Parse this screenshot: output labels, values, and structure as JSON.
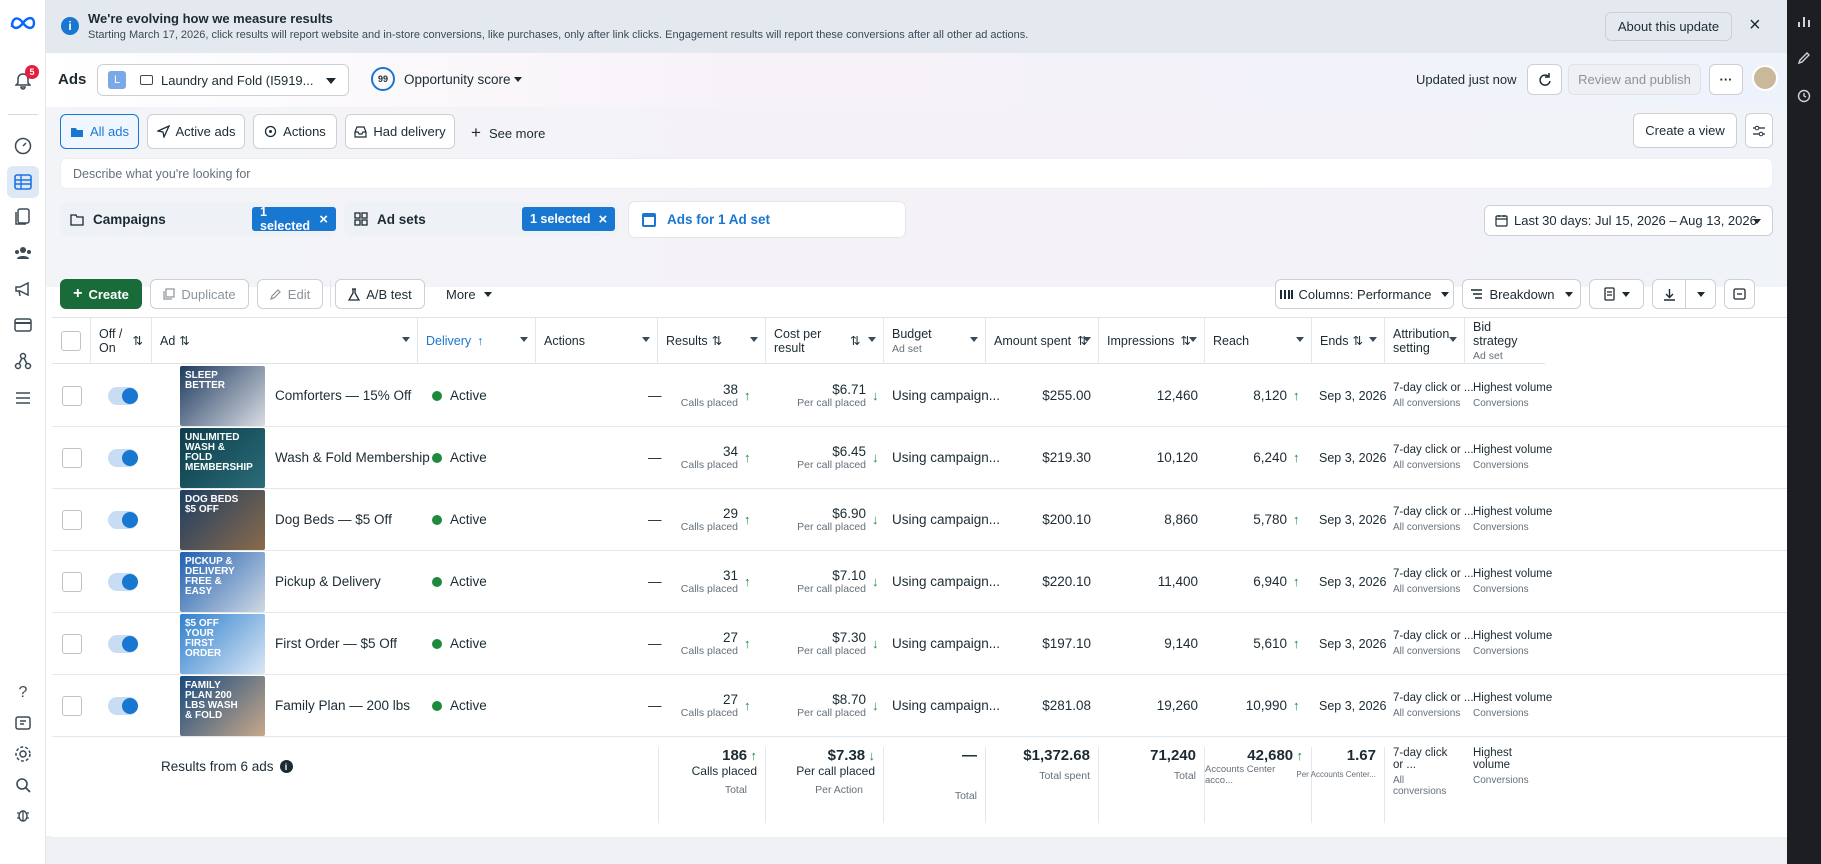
{
  "banner": {
    "title": "We're evolving how we measure results",
    "subtitle": "Starting March 17, 2026, click results will report website and in-store conversions, like purchases, only after link clicks. Engagement results will report these conversions after all other ad actions.",
    "about_button": "About this update"
  },
  "leftnav": {
    "notification_count": "5"
  },
  "topbar": {
    "section_title": "Ads",
    "account_initial": "L",
    "account_name": "Laundry and Fold (I5919...",
    "opportunity_score_value": "99",
    "opportunity_score_label": "Opportunity score",
    "updated_text": "Updated just now",
    "review_publish": "Review and publish",
    "more_label": "···"
  },
  "views": {
    "tabs": [
      "All ads",
      "Active ads",
      "Actions",
      "Had delivery"
    ],
    "see_more": "See more",
    "create_view": "Create a view"
  },
  "search": {
    "placeholder": "Describe what you're looking for"
  },
  "levels": {
    "campaigns": "Campaigns",
    "campaigns_selected": "1 selected",
    "adsets": "Ad sets",
    "adsets_selected": "1 selected",
    "ads": "Ads for 1 Ad set"
  },
  "date_range": "Last 30 days: Jul 15, 2026 – Aug 13, 2026",
  "toolbar": {
    "create": "Create",
    "duplicate": "Duplicate",
    "edit": "Edit",
    "ab_test": "A/B test",
    "more": "More",
    "columns": "Columns: Performance",
    "breakdown": "Breakdown"
  },
  "columns": {
    "onoff": "Off / On",
    "ad": "Ad",
    "delivery": "Delivery",
    "actions": "Actions",
    "results": "Results",
    "cost": "Cost per result",
    "budget": "Budget",
    "budget_sub": "Ad set",
    "amount": "Amount spent",
    "impressions": "Impressions",
    "reach": "Reach",
    "ends": "Ends",
    "attribution": "Attribution setting",
    "bid": "Bid strategy",
    "bid_sub": "Ad set"
  },
  "rows": [
    {
      "thumb": "SLEEP BETTER",
      "name": "Comforters — 15% Off",
      "delivery": "Active",
      "actions": "—",
      "results": "38",
      "results_sub": "Calls placed",
      "cost": "$6.71",
      "cost_sub": "Per call placed",
      "budget": "Using campaign...",
      "amount": "$255.00",
      "impressions": "12,460",
      "reach": "8,120",
      "ends": "Sep 3, 2026",
      "attr": "7-day click or ...",
      "attr_sub": "All conversions",
      "bid": "Highest volume",
      "bid_sub": "Conversions"
    },
    {
      "thumb": "UNLIMITED WASH & FOLD MEMBERSHIP",
      "name": "Wash & Fold Membership",
      "delivery": "Active",
      "actions": "—",
      "results": "34",
      "results_sub": "Calls placed",
      "cost": "$6.45",
      "cost_sub": "Per call placed",
      "budget": "Using campaign...",
      "amount": "$219.30",
      "impressions": "10,120",
      "reach": "6,240",
      "ends": "Sep 3, 2026",
      "attr": "7-day click or ...",
      "attr_sub": "All conversions",
      "bid": "Highest volume",
      "bid_sub": "Conversions"
    },
    {
      "thumb": "DOG BEDS $5 OFF",
      "name": "Dog Beds — $5 Off",
      "delivery": "Active",
      "actions": "—",
      "results": "29",
      "results_sub": "Calls placed",
      "cost": "$6.90",
      "cost_sub": "Per call placed",
      "budget": "Using campaign...",
      "amount": "$200.10",
      "impressions": "8,860",
      "reach": "5,780",
      "ends": "Sep 3, 2026",
      "attr": "7-day click or ...",
      "attr_sub": "All conversions",
      "bid": "Highest volume",
      "bid_sub": "Conversions"
    },
    {
      "thumb": "PICKUP & DELIVERY FREE & EASY",
      "name": "Pickup & Delivery",
      "delivery": "Active",
      "actions": "—",
      "results": "31",
      "results_sub": "Calls placed",
      "cost": "$7.10",
      "cost_sub": "Per call placed",
      "budget": "Using campaign...",
      "amount": "$220.10",
      "impressions": "11,400",
      "reach": "6,940",
      "ends": "Sep 3, 2026",
      "attr": "7-day click or ...",
      "attr_sub": "All conversions",
      "bid": "Highest volume",
      "bid_sub": "Conversions"
    },
    {
      "thumb": "$5 OFF YOUR FIRST ORDER",
      "name": "First Order — $5 Off",
      "delivery": "Active",
      "actions": "—",
      "results": "27",
      "results_sub": "Calls placed",
      "cost": "$7.30",
      "cost_sub": "Per call placed",
      "budget": "Using campaign...",
      "amount": "$197.10",
      "impressions": "9,140",
      "reach": "5,610",
      "ends": "Sep 3, 2026",
      "attr": "7-day click or ...",
      "attr_sub": "All conversions",
      "bid": "Highest volume",
      "bid_sub": "Conversions"
    },
    {
      "thumb": "FAMILY PLAN 200 LBS WASH & FOLD",
      "name": "Family Plan — 200 lbs",
      "delivery": "Active",
      "actions": "—",
      "results": "27",
      "results_sub": "Calls placed",
      "cost": "$8.70",
      "cost_sub": "Per call placed",
      "budget": "Using campaign...",
      "amount": "$281.08",
      "impressions": "19,260",
      "reach": "10,990",
      "ends": "Sep 3, 2026",
      "attr": "7-day click or ...",
      "attr_sub": "All conversions",
      "bid": "Highest volume",
      "bid_sub": "Conversions"
    }
  ],
  "totals": {
    "label": "Results from 6 ads",
    "results": "186",
    "results_sub": "Calls placed",
    "results_sub2": "Total",
    "cost": "$7.38",
    "cost_sub": "Per call placed",
    "cost_sub2": "Per Action",
    "budget": "—",
    "budget_sub": "Total",
    "amount": "$1,372.68",
    "amount_sub": "Total spent",
    "impressions": "71,240",
    "impressions_sub": "Total",
    "reach": "42,680",
    "reach_sub": "Accounts Center acco...",
    "freq": "1.67",
    "freq_sub": "Per Accounts Center...",
    "attr": "7-day click or ...",
    "attr_sub": "All conversions",
    "bid": "Highest volume",
    "bid_sub": "Conversions"
  },
  "colors": {
    "accent": "#1877d1",
    "create_green": "#1a6b3a",
    "active_dot": "#1e8a3c"
  }
}
